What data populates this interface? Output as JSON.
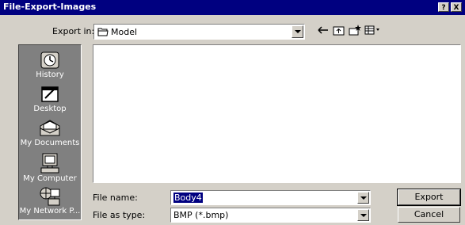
{
  "window": {
    "title": "File-Export-Images",
    "help_label": "?",
    "close_label": "X"
  },
  "lookin": {
    "label": "Export in:",
    "value": "Model",
    "folder_icon": "folder-icon"
  },
  "toolbar": {
    "back_icon": "back-arrow-icon",
    "up_icon": "up-folder-icon",
    "new_folder_icon": "new-folder-icon",
    "view_icon": "view-menu-icon"
  },
  "places": [
    {
      "label": "History",
      "icon": "history-icon"
    },
    {
      "label": "Desktop",
      "icon": "desktop-icon"
    },
    {
      "label": "My Documents",
      "icon": "my-documents-icon"
    },
    {
      "label": "My Computer",
      "icon": "my-computer-icon"
    },
    {
      "label": "My Network P...",
      "icon": "network-places-icon"
    }
  ],
  "filename": {
    "label": "File name:",
    "value": "Body4"
  },
  "filetype": {
    "label": "File as type:",
    "value": "BMP (*.bmp)"
  },
  "buttons": {
    "export": "Export",
    "cancel": "Cancel"
  }
}
